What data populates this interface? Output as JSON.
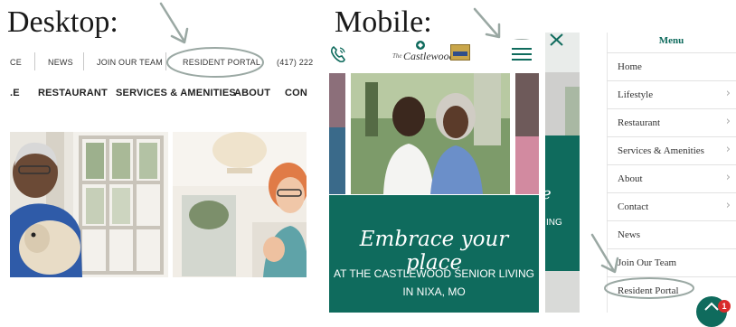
{
  "labels": {
    "desktop": "Desktop:",
    "mobile": "Mobile:"
  },
  "desktop": {
    "top_nav": [
      "CE",
      "NEWS",
      "JOIN OUR TEAM",
      "RESIDENT PORTAL",
      "(417) 222"
    ],
    "main_nav": [
      ".E",
      "RESTAURANT",
      "SERVICES & AMENITIES",
      "ABOUT",
      "CON"
    ]
  },
  "mobile": {
    "logo_text": "Castlewood",
    "logo_prefix": "The",
    "hero_title": "Embrace your place",
    "hero_subtitle_1": "AT THE CASTLEWOOD SENIOR LIVING",
    "hero_subtitle_2": "IN NIXA, MO",
    "peek_text_1": "e",
    "peek_text_2": "ING"
  },
  "menu": {
    "title": "Menu",
    "items": [
      {
        "label": "Home",
        "has_submenu": false
      },
      {
        "label": "Lifestyle",
        "has_submenu": true
      },
      {
        "label": "Restaurant",
        "has_submenu": true
      },
      {
        "label": "Services & Amenities",
        "has_submenu": true
      },
      {
        "label": "About",
        "has_submenu": true
      },
      {
        "label": "Contact",
        "has_submenu": true
      },
      {
        "label": "News",
        "has_submenu": false
      },
      {
        "label": "Join Our Team",
        "has_submenu": false
      },
      {
        "label": "Resident Portal",
        "has_submenu": false
      }
    ],
    "chat_badge_count": "1"
  },
  "colors": {
    "brand_green": "#0f6b5d",
    "annotation_gray": "#9aa8a3",
    "badge_red": "#d92b2b"
  },
  "icons": {
    "phone": "phone-icon",
    "hamburger": "hamburger-menu-icon",
    "close": "close-icon",
    "chevron": "chevron-right-icon",
    "chat": "chat-widget-icon"
  }
}
